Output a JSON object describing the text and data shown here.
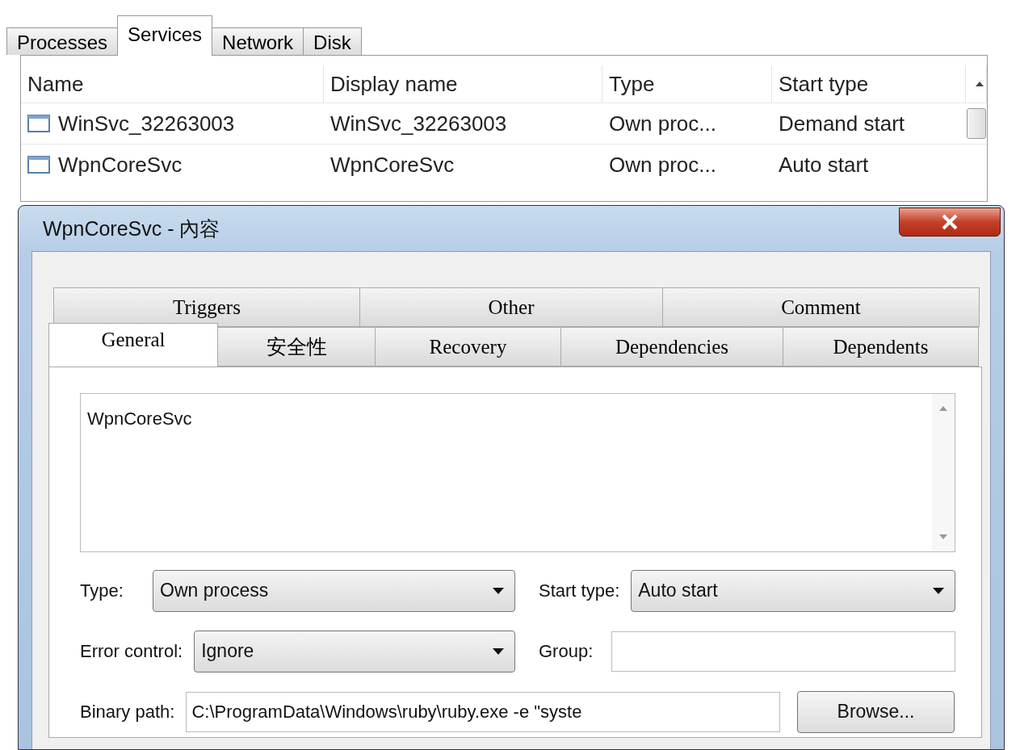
{
  "services_window": {
    "tabs": [
      {
        "label": "Processes",
        "selected": false
      },
      {
        "label": "Services",
        "selected": true
      },
      {
        "label": "Network",
        "selected": false
      },
      {
        "label": "Disk",
        "selected": false
      }
    ],
    "table": {
      "columns": [
        "Name",
        "Display name",
        "Type",
        "Start type"
      ],
      "rows": [
        {
          "cells": [
            "WinSvc_32263003",
            "WinSvc_32263003",
            "Own proc...",
            "Demand start"
          ]
        },
        {
          "cells": [
            "WpnCoreSvc",
            "WpnCoreSvc",
            "Own proc...",
            "Auto start"
          ]
        }
      ]
    }
  },
  "dialog": {
    "title": "WpnCoreSvc - 內容",
    "tab_rows": [
      [
        {
          "label": "Triggers",
          "selected": false
        },
        {
          "label": "Other",
          "selected": false
        },
        {
          "label": "Comment",
          "selected": false
        }
      ],
      [
        {
          "label": "General",
          "selected": true
        },
        {
          "label": "安全性",
          "selected": false
        },
        {
          "label": "Recovery",
          "selected": false
        },
        {
          "label": "Dependencies",
          "selected": false
        },
        {
          "label": "Dependents",
          "selected": false
        }
      ]
    ],
    "description": "WpnCoreSvc",
    "form_rows": [
      [
        {
          "kind": "select",
          "label": "Type:",
          "value": "Own process"
        },
        {
          "kind": "select",
          "label": "Start type:",
          "value": "Auto start"
        }
      ],
      [
        {
          "kind": "select",
          "label": "Error control:",
          "value": "Ignore"
        },
        {
          "kind": "text",
          "label": "Group:"
        }
      ],
      [
        {
          "kind": "text",
          "label": "Binary path:",
          "value": "C:\\ProgramData\\Windows\\ruby\\ruby.exe -e \"syste"
        },
        {
          "kind": "button",
          "label": "Browse..."
        }
      ]
    ]
  }
}
